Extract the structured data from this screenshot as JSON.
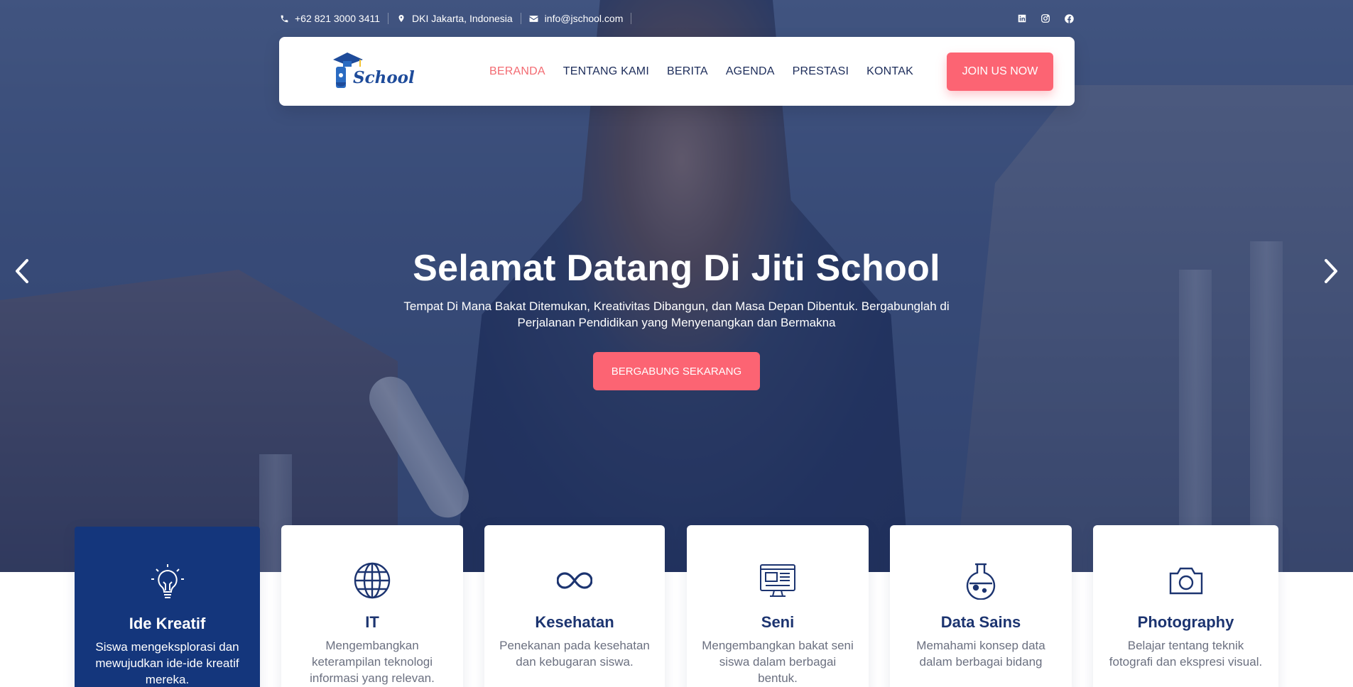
{
  "topbar": {
    "phone": "+62 821 3000 3411",
    "location": "DKI Jakarta, Indonesia",
    "email": "info@jschool.com",
    "social": [
      "linkedin-icon",
      "instagram-icon",
      "facebook-icon"
    ]
  },
  "brand": {
    "logo_text": "School"
  },
  "nav": {
    "items": [
      {
        "label": "BERANDA",
        "active": true
      },
      {
        "label": "TENTANG KAMI"
      },
      {
        "label": "BERITA"
      },
      {
        "label": "AGENDA"
      },
      {
        "label": "PRESTASI"
      },
      {
        "label": "KONTAK"
      }
    ],
    "cta": "JOIN US NOW"
  },
  "hero": {
    "title": "Selamat Datang Di Jiti School",
    "subtitle": "Tempat Di Mana Bakat Ditemukan, Kreativitas Dibangun, dan Masa Depan Dibentuk. Bergabunglah di Perjalanan Pendidikan yang Menyenangkan dan Bermakna",
    "button": "BERGABUNG SEKARANG"
  },
  "features": [
    {
      "icon": "lightbulb-icon",
      "title": "Ide Kreatif",
      "desc": "Siswa mengeksplorasi dan mewujudkan ide-ide kreatif mereka."
    },
    {
      "icon": "globe-icon",
      "title": "IT",
      "desc": "Mengembangkan keterampilan teknologi informasi yang relevan."
    },
    {
      "icon": "infinity-icon",
      "title": "Kesehatan",
      "desc": "Penekanan pada kesehatan dan kebugaran siswa."
    },
    {
      "icon": "monitor-design-icon",
      "title": "Seni",
      "desc": "Mengembangkan bakat seni siswa dalam berbagai bentuk."
    },
    {
      "icon": "flask-icon",
      "title": "Data Sains",
      "desc": "Memahami konsep data dalam berbagai bidang"
    },
    {
      "icon": "camera-icon",
      "title": "Photography",
      "desc": "Belajar tentang teknik fotografi dan ekspresi visual."
    }
  ],
  "colors": {
    "accent": "#fc6473",
    "navy": "#14367c",
    "heading": "#1c3470"
  }
}
